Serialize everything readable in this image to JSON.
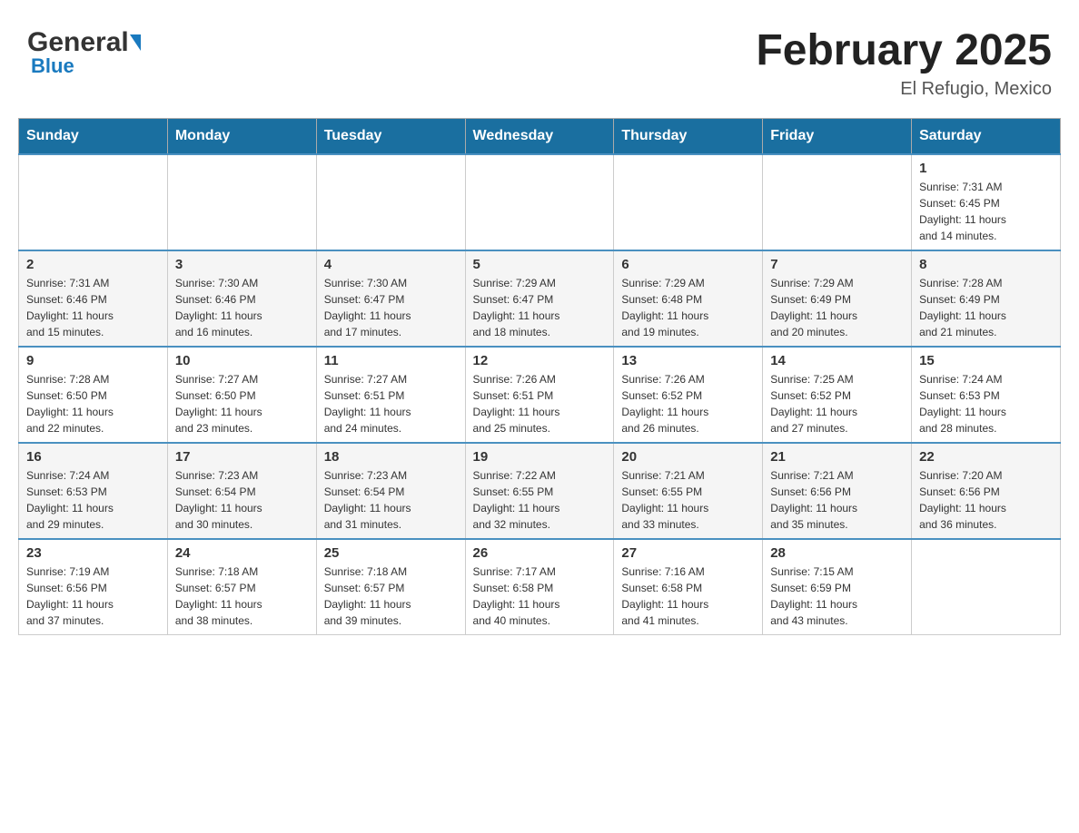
{
  "header": {
    "logo_general": "General",
    "logo_blue": "Blue",
    "month_year": "February 2025",
    "location": "El Refugio, Mexico"
  },
  "days_of_week": [
    "Sunday",
    "Monday",
    "Tuesday",
    "Wednesday",
    "Thursday",
    "Friday",
    "Saturday"
  ],
  "weeks": [
    {
      "cells": [
        {
          "day": "",
          "info": ""
        },
        {
          "day": "",
          "info": ""
        },
        {
          "day": "",
          "info": ""
        },
        {
          "day": "",
          "info": ""
        },
        {
          "day": "",
          "info": ""
        },
        {
          "day": "",
          "info": ""
        },
        {
          "day": "1",
          "info": "Sunrise: 7:31 AM\nSunset: 6:45 PM\nDaylight: 11 hours\nand 14 minutes."
        }
      ]
    },
    {
      "cells": [
        {
          "day": "2",
          "info": "Sunrise: 7:31 AM\nSunset: 6:46 PM\nDaylight: 11 hours\nand 15 minutes."
        },
        {
          "day": "3",
          "info": "Sunrise: 7:30 AM\nSunset: 6:46 PM\nDaylight: 11 hours\nand 16 minutes."
        },
        {
          "day": "4",
          "info": "Sunrise: 7:30 AM\nSunset: 6:47 PM\nDaylight: 11 hours\nand 17 minutes."
        },
        {
          "day": "5",
          "info": "Sunrise: 7:29 AM\nSunset: 6:47 PM\nDaylight: 11 hours\nand 18 minutes."
        },
        {
          "day": "6",
          "info": "Sunrise: 7:29 AM\nSunset: 6:48 PM\nDaylight: 11 hours\nand 19 minutes."
        },
        {
          "day": "7",
          "info": "Sunrise: 7:29 AM\nSunset: 6:49 PM\nDaylight: 11 hours\nand 20 minutes."
        },
        {
          "day": "8",
          "info": "Sunrise: 7:28 AM\nSunset: 6:49 PM\nDaylight: 11 hours\nand 21 minutes."
        }
      ]
    },
    {
      "cells": [
        {
          "day": "9",
          "info": "Sunrise: 7:28 AM\nSunset: 6:50 PM\nDaylight: 11 hours\nand 22 minutes."
        },
        {
          "day": "10",
          "info": "Sunrise: 7:27 AM\nSunset: 6:50 PM\nDaylight: 11 hours\nand 23 minutes."
        },
        {
          "day": "11",
          "info": "Sunrise: 7:27 AM\nSunset: 6:51 PM\nDaylight: 11 hours\nand 24 minutes."
        },
        {
          "day": "12",
          "info": "Sunrise: 7:26 AM\nSunset: 6:51 PM\nDaylight: 11 hours\nand 25 minutes."
        },
        {
          "day": "13",
          "info": "Sunrise: 7:26 AM\nSunset: 6:52 PM\nDaylight: 11 hours\nand 26 minutes."
        },
        {
          "day": "14",
          "info": "Sunrise: 7:25 AM\nSunset: 6:52 PM\nDaylight: 11 hours\nand 27 minutes."
        },
        {
          "day": "15",
          "info": "Sunrise: 7:24 AM\nSunset: 6:53 PM\nDaylight: 11 hours\nand 28 minutes."
        }
      ]
    },
    {
      "cells": [
        {
          "day": "16",
          "info": "Sunrise: 7:24 AM\nSunset: 6:53 PM\nDaylight: 11 hours\nand 29 minutes."
        },
        {
          "day": "17",
          "info": "Sunrise: 7:23 AM\nSunset: 6:54 PM\nDaylight: 11 hours\nand 30 minutes."
        },
        {
          "day": "18",
          "info": "Sunrise: 7:23 AM\nSunset: 6:54 PM\nDaylight: 11 hours\nand 31 minutes."
        },
        {
          "day": "19",
          "info": "Sunrise: 7:22 AM\nSunset: 6:55 PM\nDaylight: 11 hours\nand 32 minutes."
        },
        {
          "day": "20",
          "info": "Sunrise: 7:21 AM\nSunset: 6:55 PM\nDaylight: 11 hours\nand 33 minutes."
        },
        {
          "day": "21",
          "info": "Sunrise: 7:21 AM\nSunset: 6:56 PM\nDaylight: 11 hours\nand 35 minutes."
        },
        {
          "day": "22",
          "info": "Sunrise: 7:20 AM\nSunset: 6:56 PM\nDaylight: 11 hours\nand 36 minutes."
        }
      ]
    },
    {
      "cells": [
        {
          "day": "23",
          "info": "Sunrise: 7:19 AM\nSunset: 6:56 PM\nDaylight: 11 hours\nand 37 minutes."
        },
        {
          "day": "24",
          "info": "Sunrise: 7:18 AM\nSunset: 6:57 PM\nDaylight: 11 hours\nand 38 minutes."
        },
        {
          "day": "25",
          "info": "Sunrise: 7:18 AM\nSunset: 6:57 PM\nDaylight: 11 hours\nand 39 minutes."
        },
        {
          "day": "26",
          "info": "Sunrise: 7:17 AM\nSunset: 6:58 PM\nDaylight: 11 hours\nand 40 minutes."
        },
        {
          "day": "27",
          "info": "Sunrise: 7:16 AM\nSunset: 6:58 PM\nDaylight: 11 hours\nand 41 minutes."
        },
        {
          "day": "28",
          "info": "Sunrise: 7:15 AM\nSunset: 6:59 PM\nDaylight: 11 hours\nand 43 minutes."
        },
        {
          "day": "",
          "info": ""
        }
      ]
    }
  ]
}
